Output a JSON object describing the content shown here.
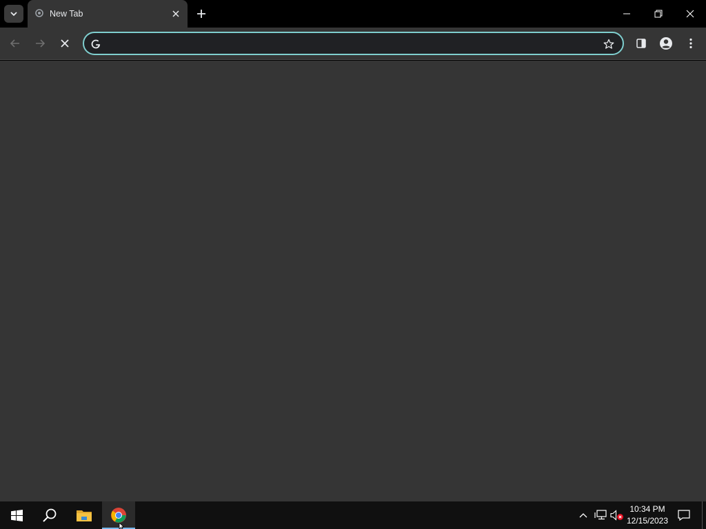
{
  "browser": {
    "tab": {
      "title": "New Tab",
      "favicon": "loading-favicon-icon"
    },
    "omnibox": {
      "value": "",
      "placeholder": ""
    },
    "colors": {
      "accent": "#7fcfcf",
      "frame": "#000000",
      "toolbar": "#353535",
      "omnibox": "#202124"
    }
  },
  "taskbar": {
    "apps": [
      "start-icon",
      "search-icon",
      "file-explorer-icon",
      "chrome-icon"
    ],
    "clock": {
      "time": "10:34 PM",
      "date": "12/15/2023"
    },
    "accent": "#76b9ed"
  }
}
